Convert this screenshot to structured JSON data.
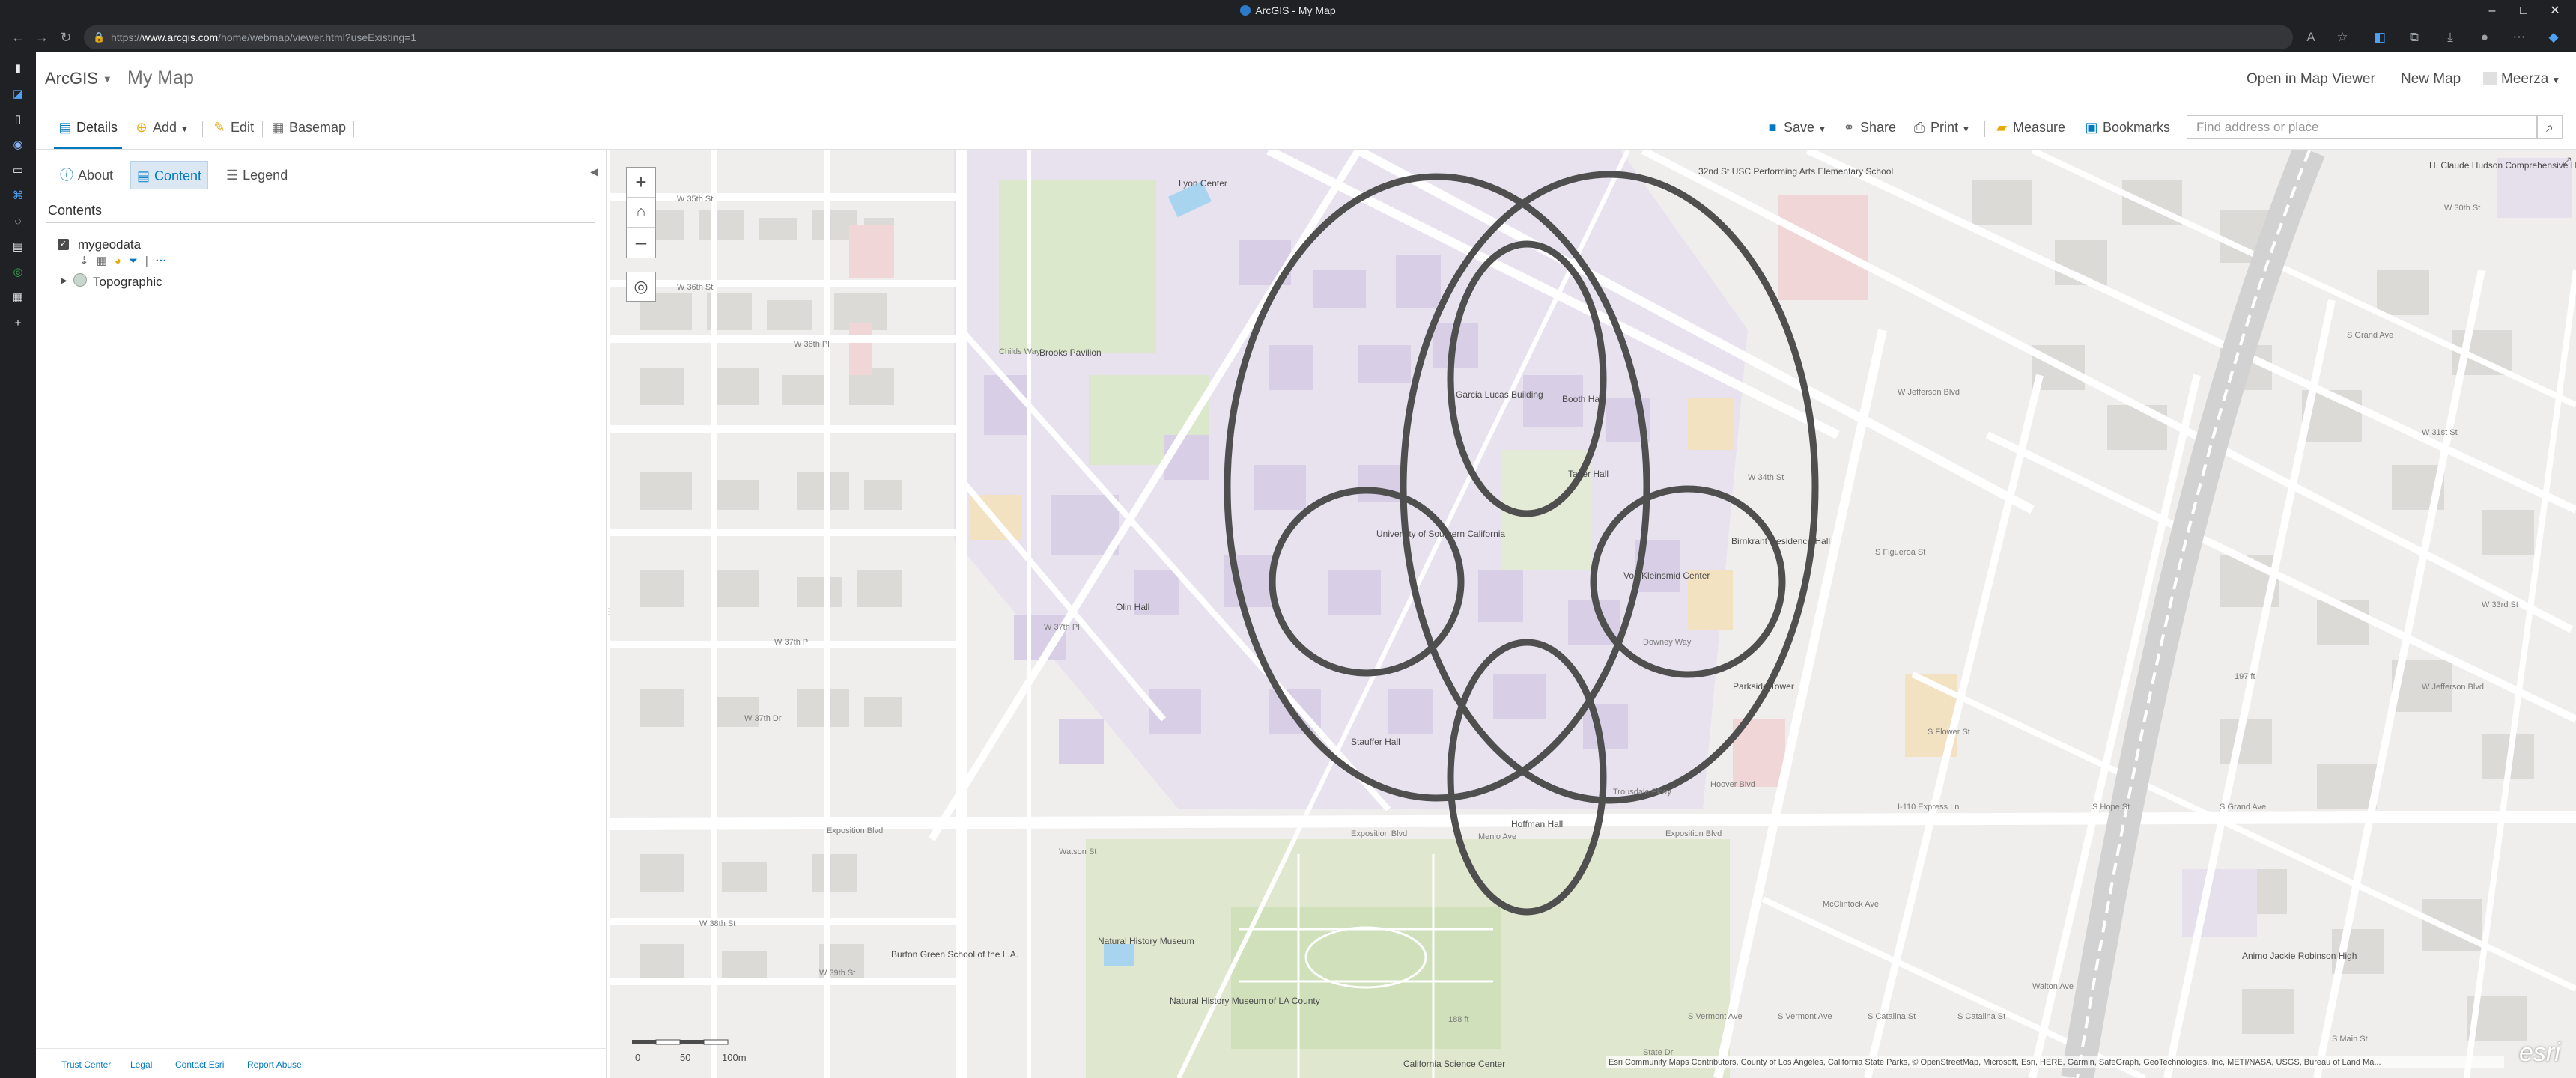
{
  "browser": {
    "tab_title": "ArcGIS - My Map",
    "url_prefix": "https://",
    "url_host": "www.arcgis.com",
    "url_path": "/home/webmap/viewer.html?useExisting=1"
  },
  "header": {
    "brand": "ArcGIS",
    "map_name": "My Map",
    "open_in_map_viewer": "Open in Map Viewer",
    "new_map": "New Map",
    "user": "Meerza"
  },
  "toolbar": {
    "details": "Details",
    "add": "Add",
    "edit": "Edit",
    "basemap": "Basemap",
    "save": "Save",
    "share": "Share",
    "print": "Print",
    "measure": "Measure",
    "bookmarks": "Bookmarks",
    "search_placeholder": "Find address or place"
  },
  "panel": {
    "tabs": [
      "About",
      "Content",
      "Legend"
    ],
    "contents_heading": "Contents",
    "layers": [
      {
        "name": "mygeodata",
        "checked": true
      },
      {
        "name": "Topographic",
        "checked": false
      }
    ],
    "footer_links": [
      "Trust Center",
      "Legal",
      "Contact Esri",
      "Report Abuse"
    ]
  },
  "map": {
    "zoom_in": "+",
    "zoom_out": "–",
    "scale_labels": [
      "0",
      "50",
      "100m"
    ],
    "attribution": "Esri Community Maps Contributors, County of Los Angeles, California State Parks, © OpenStreetMap, Microsoft, Esri, HERE, Garmin, SafeGraph, GeoTechnologies, Inc, METI/NASA, USGS, Bureau of Land Ma...",
    "esri_logo": "esri",
    "labels": {
      "lyon_center": "Lyon Center",
      "brooks_pavilion": "Brooks Pavilion",
      "garcia_lucas": "Garcia Lucas Building",
      "booth_hall": "Booth Hall",
      "taper_hall": "Taper Hall",
      "usc": "University of Southern California",
      "birnkrant": "Birnkrant Residence Hall",
      "olin_hall": "Olin Hall",
      "kleinsmid": "Von Kleinsmid Center",
      "parkside_tower": "Parkside Tower",
      "stauffer_hall": "Stauffer Hall",
      "hoffman_hall": "Hoffman Hall",
      "nhm_museum": "Natural History Museum",
      "nhm_la": "Natural History Museum of LA County",
      "burton_green": "Burton Green School of the L.A.",
      "science_center": "California Science Center",
      "elementary": "32nd St USC Performing Arts Elementary School",
      "hudson_center": "H. Claude Hudson Comprehensive Health Center",
      "animo": "Animo Jackie Robinson High",
      "w35th": "W 35th St",
      "w36th": "W 36th St",
      "w36thpl": "W 36th Pl",
      "w37thpl": "W 37th Pl",
      "w37thdr": "W 37th Dr",
      "w38th": "W 38th St",
      "w39th": "W 39th St",
      "exposition1": "Exposition Blvd",
      "exposition2": "Exposition Blvd",
      "exposition3": "Exposition Blvd",
      "vermont1": "S Vermont Ave",
      "vermont2": "S Vermont Ave",
      "catalina1": "S Catalina St",
      "catalina2": "S Catalina St",
      "childs_way": "Childs Way",
      "downey_way": "Downey Way",
      "figueroa": "S Figueroa St",
      "flower": "S Flower St",
      "jefferson": "W Jefferson Blvd",
      "i110": "I-110 Express Ln",
      "w34th": "W 34th St",
      "state_dr": "State Dr",
      "mcclintock": "McClintock Ave",
      "trousdale": "Trousdale Pkwy",
      "hope": "S Hope St",
      "grand": "S Grand Ave",
      "w30th": "W 30th St",
      "w31st": "W 31st St",
      "w33rd": "W 33rd St",
      "w37th": "W 37th Pl",
      "wilton": "Walton Ave",
      "watson": "Watson St",
      "menlo": "Menlo Ave",
      "hoover": "Hoover Blvd",
      "main": "S Main St",
      "r197": "197 ft",
      "r188": "188 ft"
    }
  }
}
